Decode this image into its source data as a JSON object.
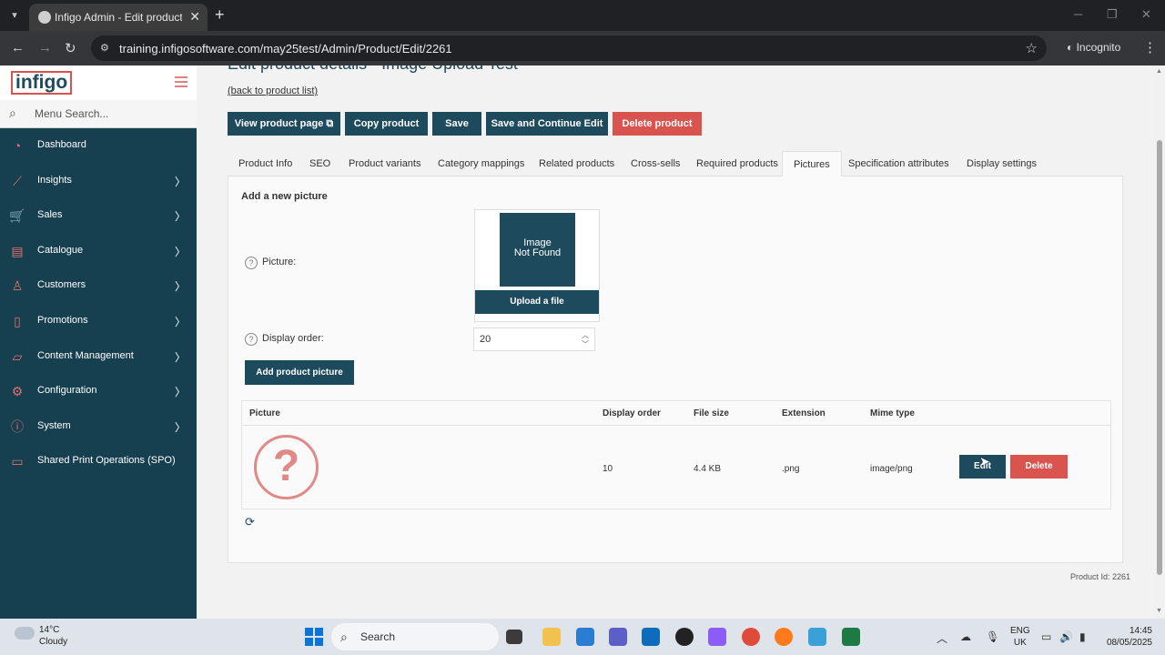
{
  "browser": {
    "tab_title": "Infigo Admin - Edit product det",
    "url": "training.infigosoftware.com/may25test/Admin/Product/Edit/2261",
    "incognito_label": "Incognito",
    "icons": {
      "tab_menu": "chevron-down-icon",
      "close_tab": "close-icon",
      "new_tab": "plus-icon",
      "back": "arrow-left-icon",
      "forward": "arrow-right-icon",
      "reload": "reload-icon",
      "site_info": "site-info-icon",
      "bookmark": "star-icon",
      "menu": "kebab-icon"
    }
  },
  "sidebar": {
    "logo_text": "infigo",
    "search_placeholder": "Menu Search...",
    "items": [
      {
        "label": "Dashboard",
        "icon": "gauge-icon",
        "has_children": false
      },
      {
        "label": "Insights",
        "icon": "chart-line-icon",
        "has_children": true
      },
      {
        "label": "Sales",
        "icon": "cart-icon",
        "has_children": true
      },
      {
        "label": "Catalogue",
        "icon": "book-icon",
        "has_children": true
      },
      {
        "label": "Customers",
        "icon": "user-icon",
        "has_children": true
      },
      {
        "label": "Promotions",
        "icon": "tag-icon",
        "has_children": true
      },
      {
        "label": "Content Management",
        "icon": "folder-icon",
        "has_children": true
      },
      {
        "label": "Configuration",
        "icon": "gear-icon",
        "has_children": true
      },
      {
        "label": "System",
        "icon": "info-icon",
        "has_children": true
      },
      {
        "label": "Shared Print Operations (SPO)",
        "icon": "monitor-icon",
        "has_children": false
      }
    ]
  },
  "main": {
    "title": "Edit product details - Image Upload Test",
    "back_link": "(back to product list)",
    "toolbar": {
      "view_product_page": "View product page",
      "copy_product": "Copy product",
      "save": "Save",
      "save_continue": "Save and Continue Edit",
      "delete_product": "Delete product"
    },
    "tabs": [
      "Product Info",
      "SEO",
      "Product variants",
      "Category mappings",
      "Related products",
      "Cross-sells",
      "Required products",
      "Pictures",
      "Specification attributes",
      "Display settings"
    ],
    "active_tab": "Pictures",
    "add_picture": {
      "heading": "Add a new picture",
      "picture_label": "Picture:",
      "image_placeholder_line1": "Image",
      "image_placeholder_line2": "Not Found",
      "upload_button": "Upload a file",
      "display_order_label": "Display order:",
      "display_order_value": "20",
      "add_button": "Add product picture"
    },
    "grid": {
      "headers": [
        "Picture",
        "Display order",
        "File size",
        "Extension",
        "Mime type"
      ],
      "rows": [
        {
          "display_order": "10",
          "file_size": "4.4 KB",
          "extension": ".png",
          "mime_type": "image/png",
          "edit_label": "Edit",
          "delete_label": "Delete"
        }
      ]
    },
    "product_id": "Product Id: 2261"
  },
  "taskbar": {
    "weather_temp": "14°C",
    "weather_desc": "Cloudy",
    "search_label": "Search",
    "lang_line1": "ENG",
    "lang_line2": "UK",
    "time": "14:45",
    "date": "08/05/2025"
  },
  "colors": {
    "brand_dark": "#1d4a5c",
    "brand_red": "#d9534f",
    "sidebar_bg": "#163f4f"
  }
}
